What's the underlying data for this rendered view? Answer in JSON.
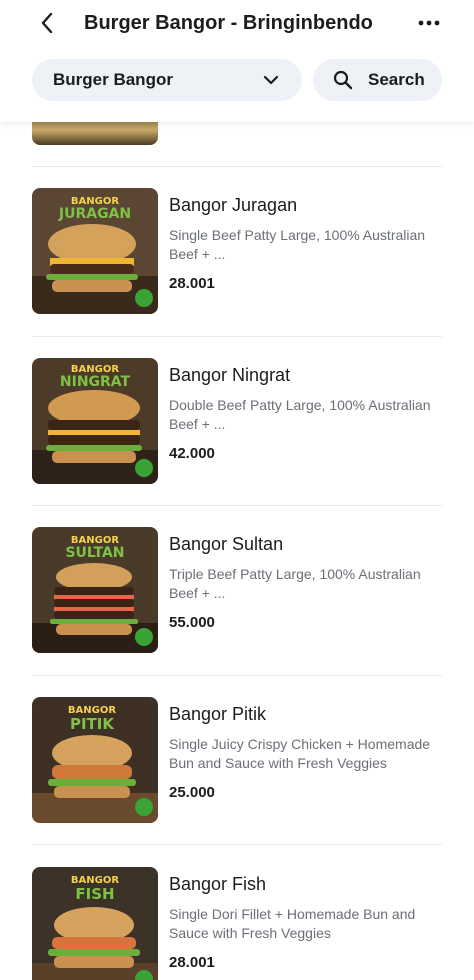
{
  "header": {
    "title": "Burger Bangor - Bringinbendo",
    "back_icon": "chevron-left-icon",
    "more_icon": "more-horizontal-icon"
  },
  "filter": {
    "selected": "Burger Bangor",
    "chevron_icon": "chevron-down-icon"
  },
  "search": {
    "label": "Search",
    "icon": "search-icon"
  },
  "colors": {
    "text_primary": "#1c1c1c",
    "text_secondary": "#6b6f76",
    "pill_bg": "#eef1f5",
    "divider": "#e9eaec",
    "badge_green": "#3aa335"
  },
  "menu": {
    "items": [
      {
        "name": "Bangor Juragan",
        "description": "Single Beef Patty Large, 100% Australian Beef + ...",
        "price": "28.001",
        "image_text": [
          "BANGOR",
          "JURAGAN"
        ]
      },
      {
        "name": "Bangor Ningrat",
        "description": "Double Beef Patty Large, 100% Australian Beef + ...",
        "price": "42.000",
        "image_text": [
          "BANGOR",
          "NINGRAT"
        ]
      },
      {
        "name": "Bangor Sultan",
        "description": "Triple Beef Patty Large, 100% Australian Beef + ...",
        "price": "55.000",
        "image_text": [
          "BANGOR",
          "SULTAN"
        ]
      },
      {
        "name": "Bangor Pitik",
        "description": "Single Juicy Crispy Chicken + Homemade Bun and Sauce with Fresh Veggies",
        "price": "25.000",
        "image_text": [
          "BANGOR",
          "PITIK"
        ]
      },
      {
        "name": "Bangor Fish",
        "description": "Single Dori Fillet + Homemade Bun and Sauce with Fresh Veggies",
        "price": "28.001",
        "image_text": [
          "BANGOR",
          "FISH"
        ]
      }
    ]
  }
}
